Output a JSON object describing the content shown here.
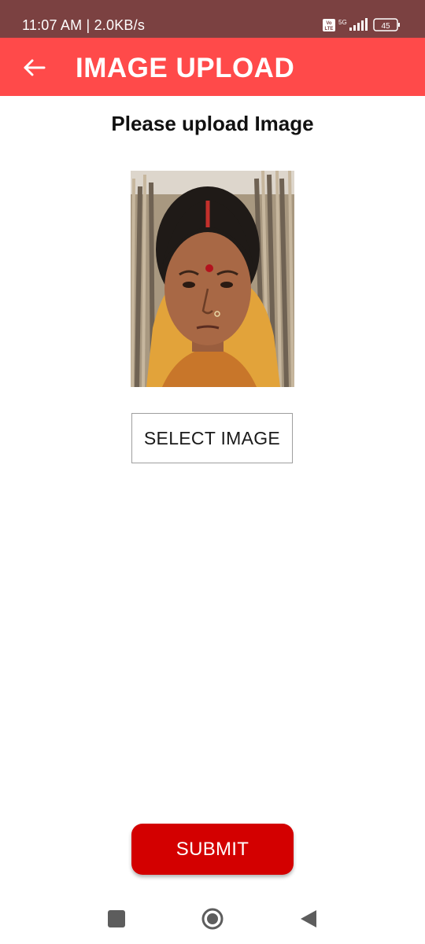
{
  "status_bar": {
    "time_speed": "11:07 AM | 2.0KB/s",
    "volte_label": "Vo LTE",
    "network": "5G",
    "battery": "45"
  },
  "app_bar": {
    "title": "IMAGE UPLOAD",
    "back_icon": "arrow-left-icon"
  },
  "main": {
    "heading": "Please upload Image",
    "select_button": "SELECT IMAGE",
    "submit_button": "SUBMIT"
  },
  "nav_bar": {
    "icons": [
      "square-icon",
      "home-circle-icon",
      "back-triangle-icon"
    ]
  },
  "colors": {
    "status_bar": "#7b4141",
    "app_bar": "#ff4a4a",
    "submit": "#d30000"
  }
}
